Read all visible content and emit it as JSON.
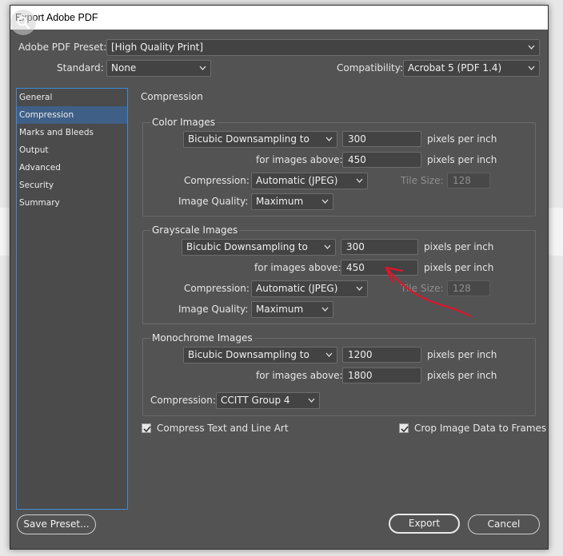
{
  "window": {
    "title": "Export Adobe PDF"
  },
  "preset": {
    "label": "Adobe PDF Preset:",
    "value": "[High Quality Print]"
  },
  "standard": {
    "label": "Standard:",
    "value": "None"
  },
  "compatibility": {
    "label": "Compatibility:",
    "value": "Acrobat 5 (PDF 1.4)"
  },
  "sidebar": {
    "items": [
      {
        "label": "General"
      },
      {
        "label": "Compression"
      },
      {
        "label": "Marks and Bleeds"
      },
      {
        "label": "Output"
      },
      {
        "label": "Advanced"
      },
      {
        "label": "Security"
      },
      {
        "label": "Summary"
      }
    ],
    "active": "Compression"
  },
  "panel": {
    "title": "Compression"
  },
  "color": {
    "title": "Color Images",
    "downsample": "Bicubic Downsampling to",
    "ppi": "300",
    "ppi_unit": "pixels per inch",
    "above_label": "for images above:",
    "above": "450",
    "above_unit": "pixels per inch",
    "compression_label": "Compression:",
    "compression": "Automatic (JPEG)",
    "tile_label": "Tile Size:",
    "tile": "128",
    "quality_label": "Image Quality:",
    "quality": "Maximum"
  },
  "gray": {
    "title": "Grayscale Images",
    "downsample": "Bicubic Downsampling to",
    "ppi": "300",
    "ppi_unit": "pixels per inch",
    "above_label": "for images above:",
    "above": "450",
    "above_unit": "pixels per inch",
    "compression_label": "Compression:",
    "compression": "Automatic (JPEG)",
    "tile_label": "Tile Size:",
    "tile": "128",
    "quality_label": "Image Quality:",
    "quality": "Maximum"
  },
  "mono": {
    "title": "Monochrome Images",
    "downsample": "Bicubic Downsampling to",
    "ppi": "1200",
    "ppi_unit": "pixels per inch",
    "above_label": "for images above:",
    "above": "1800",
    "above_unit": "pixels per inch",
    "compression_label": "Compression:",
    "compression": "CCITT Group 4"
  },
  "options": {
    "compress_text": {
      "label": "Compress Text and Line Art",
      "checked": true
    },
    "crop_image": {
      "label": "Crop Image Data to Frames",
      "checked": true
    }
  },
  "buttons": {
    "save_preset": "Save Preset...",
    "export": "Export",
    "cancel": "Cancel"
  },
  "colors": {
    "dialog_bg": "#535353",
    "accent": "#3f8ad3",
    "selected": "#3f5f87",
    "annotation": "#e0142a"
  }
}
